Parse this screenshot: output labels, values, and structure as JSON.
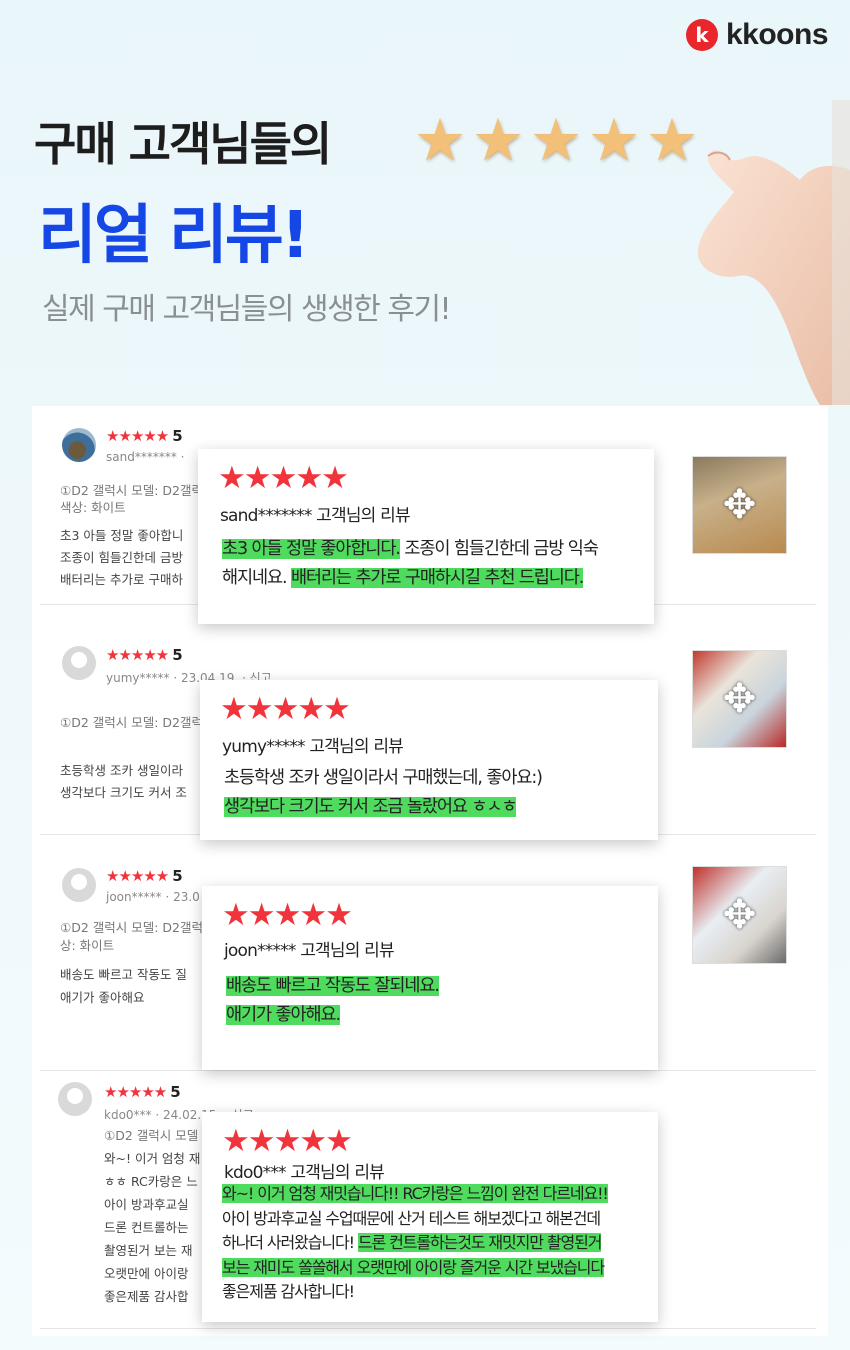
{
  "brand": {
    "logo_mark": "k",
    "logo_text": "kkoons",
    "accent": "#e8262b"
  },
  "hero": {
    "title_line1": "구매 고객님들의",
    "title_line2": "리얼 리뷰!",
    "subtitle": "실제 구매 고객님들의 생생한 후기!",
    "star_count": 5,
    "title_color": "#1447e6"
  },
  "reviews": [
    {
      "rating": "5",
      "stars": "★★★★★",
      "user": "sand*******",
      "meta": "sand******* · ",
      "option_line1": "①D2 갤럭시 모델: D2갤럭",
      "option_line2": "색상: 화이트",
      "bg_lines": [
        "초3 아들 정말 좋아합니",
        "조종이 힘들긴한데 금방",
        "배터리는 추가로 구매하"
      ],
      "card_title": "sand*******  고객님의 리뷰",
      "card_segments": [
        [
          {
            "t": "초3 아들 정말 좋아합니다.",
            "hl": true
          },
          {
            "t": " 조종이 힘들긴한데 금방 익숙",
            "hl": false
          }
        ],
        [
          {
            "t": "해지네요. ",
            "hl": false
          },
          {
            "t": "배터리는 추가로 구매하시길 추천 드립니다. ",
            "hl": true
          }
        ]
      ]
    },
    {
      "rating": "5",
      "stars": "★★★★★",
      "user": "yumy*****",
      "meta": "yumy***** · 23.04.19. · 신고",
      "option_line1": "①D2 갤럭시 모델: D2갤럭",
      "option_line2": "",
      "bg_lines": [
        "초등학생 조카 생일이라",
        "생각보다 크기도 커서 조"
      ],
      "card_title": "yumy*****  고객님의 리뷰",
      "card_segments": [
        [
          {
            "t": "초등학생 조카 생일이라서 구매했는데, 좋아요:)",
            "hl": false
          }
        ],
        [
          {
            "t": "생각보다 크기도 커서 조금 놀랐어요 ㅎㅅㅎ ",
            "hl": true
          }
        ]
      ]
    },
    {
      "rating": "5",
      "stars": "★★★★★",
      "user": "joon*****",
      "meta": "joon***** · 23.0",
      "option_line1": "①D2 갤럭시 모델: D2갤럭",
      "option_line2": "상: 화이트",
      "bg_lines": [
        "배송도 빠르고 작동도 질",
        "애기가 좋아해요"
      ],
      "card_title": "joon*****  고객님의 리뷰",
      "card_segments": [
        [
          {
            "t": "배송도 빠르고 작동도 잘되네요.  ",
            "hl": true
          }
        ],
        [
          {
            "t": "애기가 좋아해요. ",
            "hl": true
          }
        ]
      ]
    },
    {
      "rating": "5",
      "stars": "★★★★★",
      "user": "kdo0***",
      "meta": "kdo0*** · 24.02.15. · 신고",
      "option_line1": "①D2 갤럭시 모델",
      "option_line2": "",
      "bg_lines": [
        "와~! 이거 엄청 재",
        "ㅎㅎ RC카랑은 느",
        "아이 방과후교실",
        "드론 컨트롤하는",
        "촬영된거 보는 재",
        "오랫만에 아이랑",
        "좋은제품 감사합"
      ],
      "card_title": "kdo0***  고객님의 리뷰",
      "card_segments": [
        [
          {
            "t": "와~! 이거 엄청 재밋습니다!!  RC카랑은 느낌이 완전 다르네요!! ",
            "hl": true
          }
        ],
        [
          {
            "t": "아이 방과후교실 수업때문에 산거 테스트 해보겠다고 해본건데",
            "hl": false
          }
        ],
        [
          {
            "t": "하나더 사러왔습니다! ",
            "hl": false
          },
          {
            "t": "드론 컨트롤하는것도 재밋지만 촬영된거",
            "hl": true
          }
        ],
        [
          {
            "t": "보는 재미도 쏠쏠해서 오랫만에 아이랑 즐거운 시간 보냈습니다",
            "hl": true
          }
        ],
        [
          {
            "t": "좋은제품 감사합니다!",
            "hl": false
          }
        ]
      ]
    }
  ],
  "colors": {
    "star_red": "#f1343b",
    "highlight": "#4fdc5e",
    "star_gold": "#f2c079"
  }
}
